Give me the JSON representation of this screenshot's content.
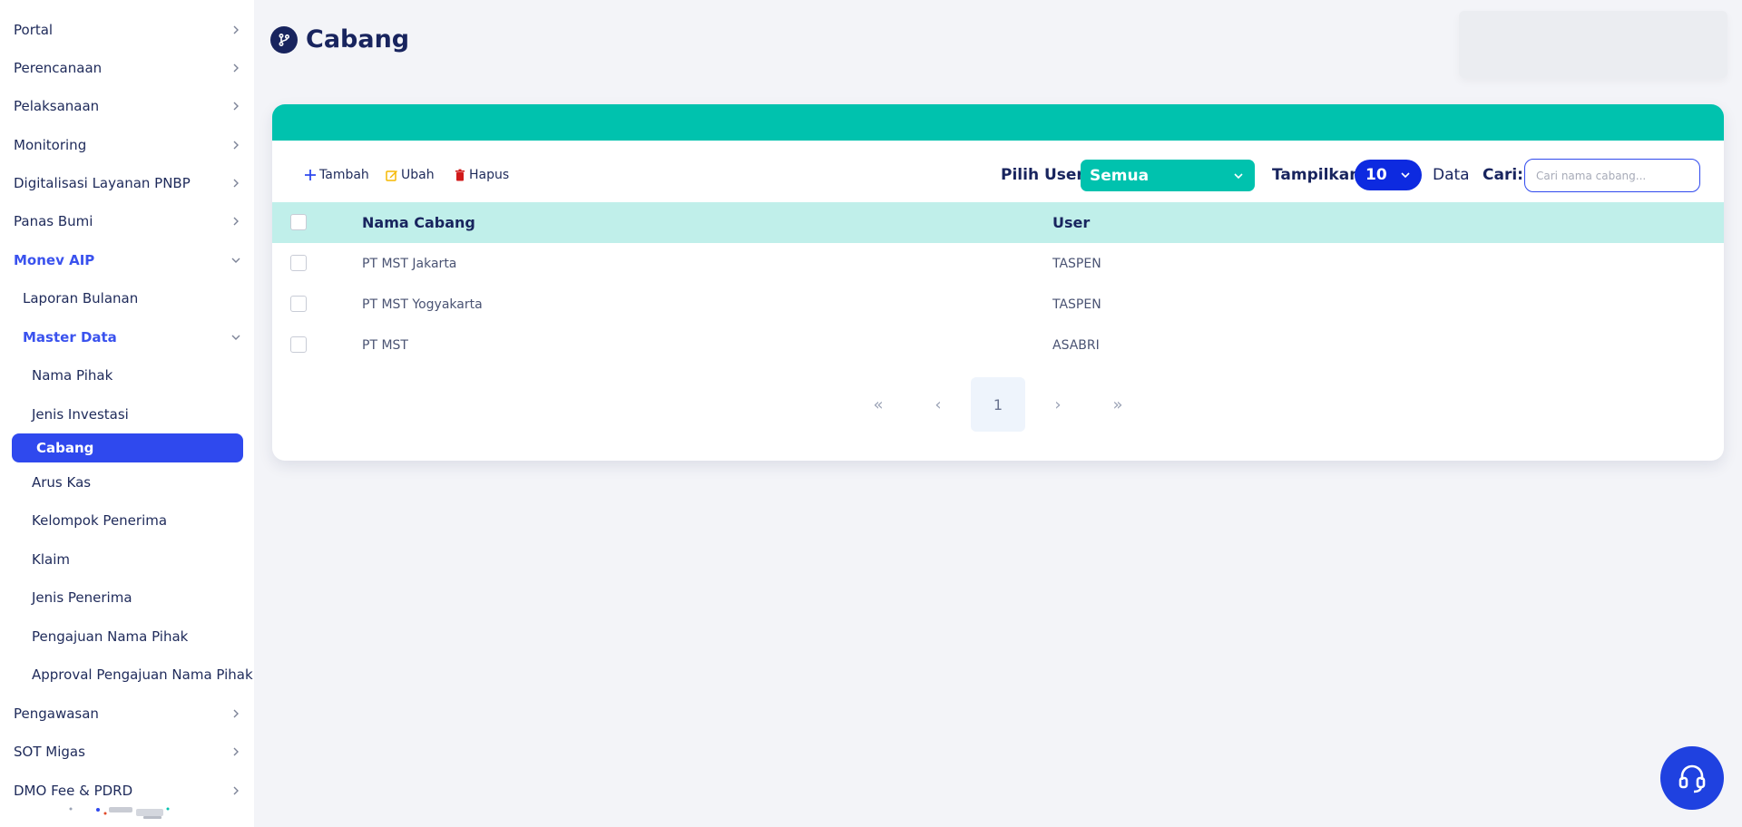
{
  "sidebar": {
    "items": [
      {
        "label": "Portal"
      },
      {
        "label": "Perencanaan"
      },
      {
        "label": "Pelaksanaan"
      },
      {
        "label": "Monitoring"
      },
      {
        "label": "Digitalisasi Layanan PNBP"
      },
      {
        "label": "Panas Bumi"
      },
      {
        "label": "Monev AIP"
      },
      {
        "label": "Laporan Bulanan"
      },
      {
        "label": "Master Data"
      },
      {
        "label": "Nama Pihak"
      },
      {
        "label": "Jenis Investasi"
      },
      {
        "label": "Cabang"
      },
      {
        "label": "Arus Kas"
      },
      {
        "label": "Kelompok Penerima"
      },
      {
        "label": "Klaim"
      },
      {
        "label": "Jenis Penerima"
      },
      {
        "label": "Pengajuan Nama Pihak"
      },
      {
        "label": "Approval Pengajuan Nama Pihak"
      },
      {
        "label": "Pengawasan"
      },
      {
        "label": "SOT Migas"
      },
      {
        "label": "DMO Fee & PDRD"
      }
    ]
  },
  "header": {
    "title": "Cabang"
  },
  "toolbar": {
    "add_label": "Tambah",
    "edit_label": "Ubah",
    "delete_label": "Hapus",
    "user_filter_label": "Pilih User:",
    "user_filter_value": "Semua",
    "page_size_label": "Tampilkan",
    "page_size_value": "10",
    "page_size_suffix": "Data",
    "search_label": "Cari:",
    "search_placeholder": "Cari nama cabang..."
  },
  "table": {
    "columns": [
      "Nama Cabang",
      "User"
    ],
    "rows": [
      {
        "nama_cabang": "PT MST Jakarta",
        "user": "TASPEN"
      },
      {
        "nama_cabang": "PT MST Yogyakarta",
        "user": "TASPEN"
      },
      {
        "nama_cabang": "PT MST",
        "user": "ASABRI"
      }
    ]
  },
  "pagination": {
    "first": "«",
    "prev": "‹",
    "current": "1",
    "next": "›",
    "last": "»"
  },
  "icons": {
    "title": "branch-icon",
    "add": "plus-icon",
    "edit": "edit-icon",
    "delete": "trash-icon",
    "help": "headset-icon"
  },
  "colors": {
    "primary": "#2f49ee",
    "accent": "#00c2ae",
    "header_band": "#00c2ae",
    "table_header": "#c0efea",
    "edit_icon": "#f5b800",
    "delete_icon": "#d11a1a",
    "page_size_select": "#0d2ae0"
  }
}
